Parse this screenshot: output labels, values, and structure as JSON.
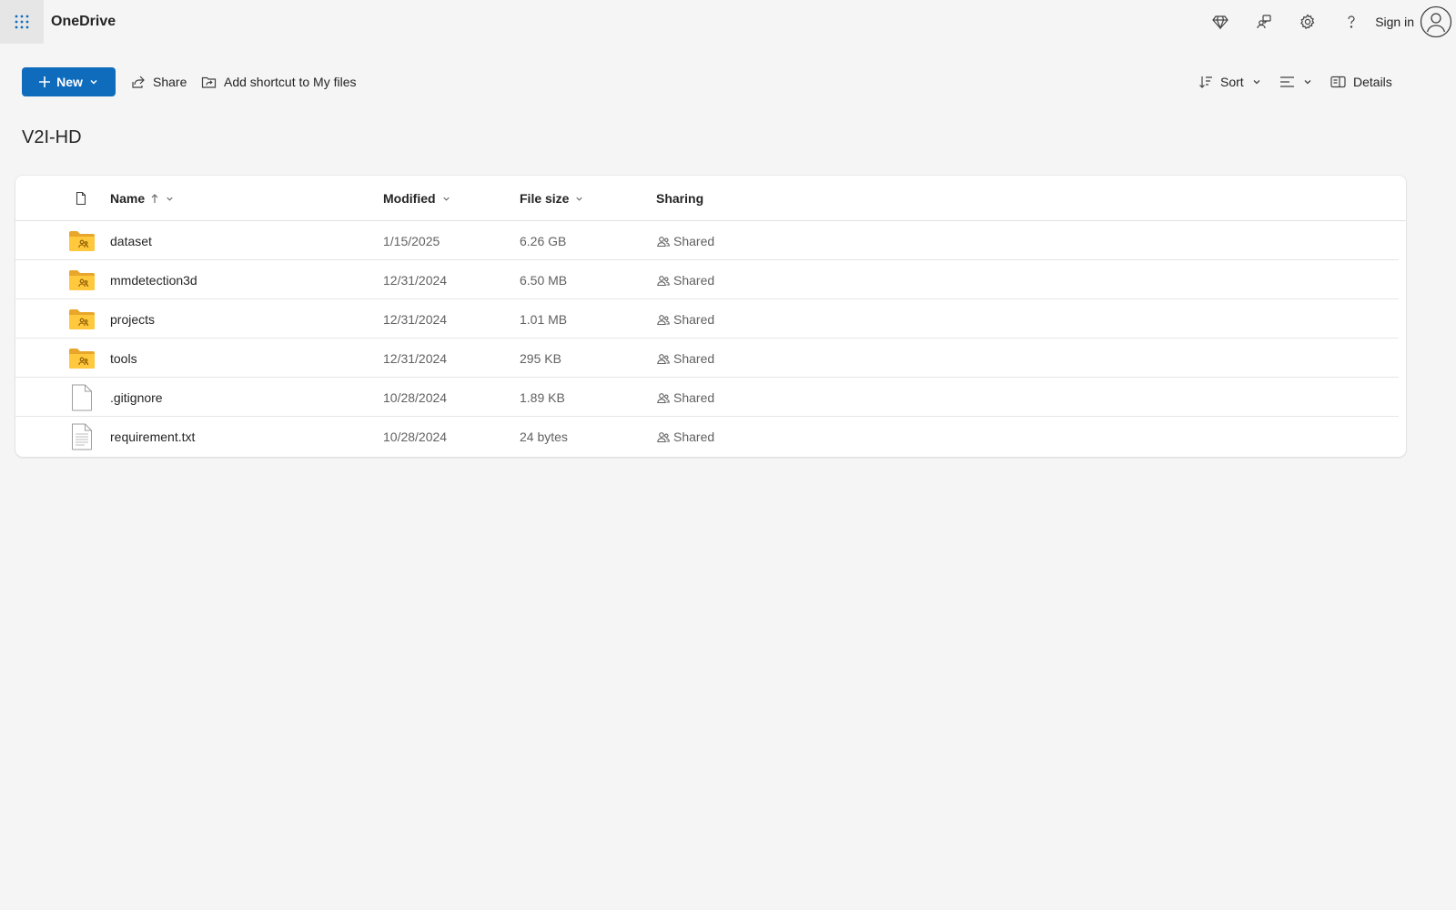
{
  "app": {
    "title": "OneDrive",
    "signin_label": "Sign in"
  },
  "toolbar": {
    "new_label": "New",
    "share_label": "Share",
    "shortcut_label": "Add shortcut to My files",
    "sort_label": "Sort",
    "details_label": "Details"
  },
  "folder": {
    "title": "V2I-HD"
  },
  "columns": {
    "name": "Name",
    "modified": "Modified",
    "size": "File size",
    "sharing": "Sharing"
  },
  "files": [
    {
      "name": "dataset",
      "modified": "1/15/2025",
      "size": "6.26 GB",
      "sharing": "Shared",
      "kind": "shared-folder-icon"
    },
    {
      "name": "mmdetection3d",
      "modified": "12/31/2024",
      "size": "6.50 MB",
      "sharing": "Shared",
      "kind": "shared-folder-icon"
    },
    {
      "name": "projects",
      "modified": "12/31/2024",
      "size": "1.01 MB",
      "sharing": "Shared",
      "kind": "shared-folder-icon"
    },
    {
      "name": "tools",
      "modified": "12/31/2024",
      "size": "295 KB",
      "sharing": "Shared",
      "kind": "shared-folder-icon"
    },
    {
      "name": ".gitignore",
      "modified": "10/28/2024",
      "size": "1.89 KB",
      "sharing": "Shared",
      "kind": "generic-file-icon"
    },
    {
      "name": "requirement.txt",
      "modified": "10/28/2024",
      "size": "24 bytes",
      "sharing": "Shared",
      "kind": "text-file-icon"
    }
  ],
  "colors": {
    "accent": "#0f6cbd",
    "folder": "#ffc83d",
    "folder_back": "#e8a72a"
  }
}
